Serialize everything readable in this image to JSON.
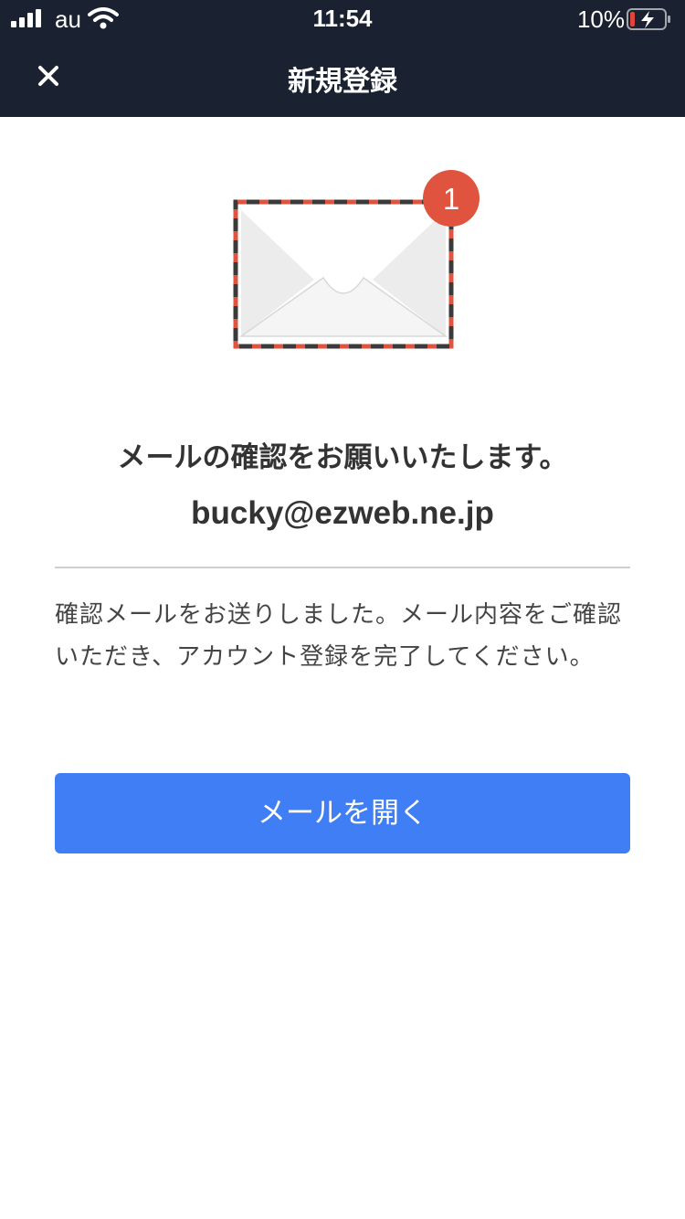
{
  "status_bar": {
    "carrier": "au",
    "time": "11:54",
    "battery_percent": "10%"
  },
  "nav": {
    "title": "新規登録",
    "close_icon": "close-icon"
  },
  "illustration": {
    "badge_count": "1",
    "icon": "envelope-icon"
  },
  "content": {
    "headline": "メールの確認をお願いいたします。",
    "email": "bucky@ezweb.ne.jp",
    "message": "確認メールをお送りしました。メール内容をご確認いただき、アカウント登録を完了してください。",
    "open_mail_label": "メールを開く"
  },
  "colors": {
    "header_bg": "#1a2232",
    "button_bg": "#3f7ef4",
    "badge_red": "#e0543f",
    "text_dark": "#333333"
  }
}
